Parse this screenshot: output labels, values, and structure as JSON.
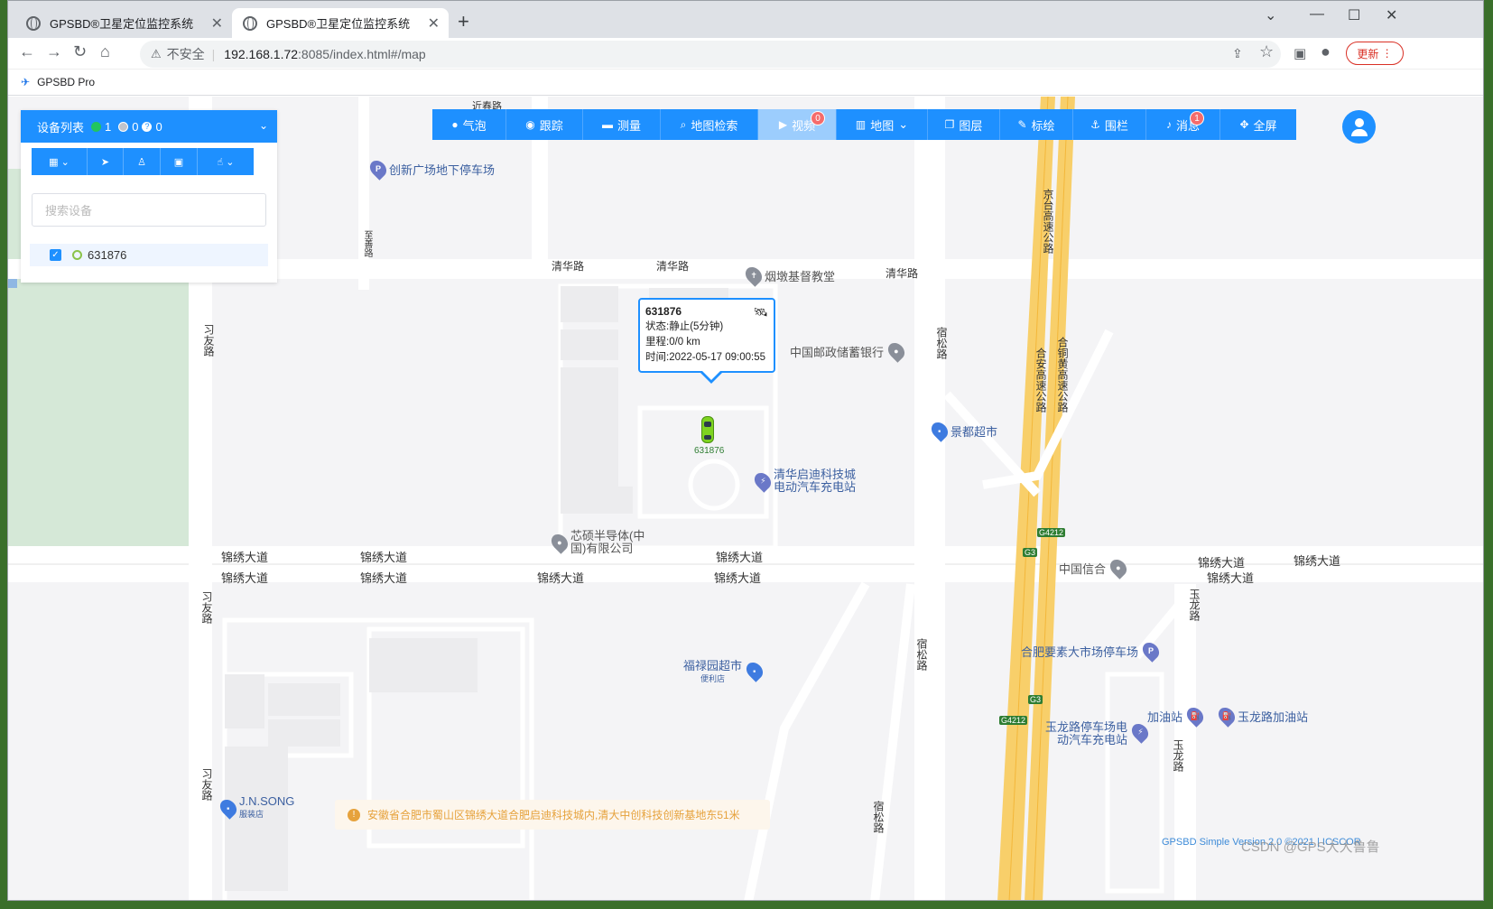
{
  "browser": {
    "tabs": [
      {
        "title": "GPSBD®卫星定位监控系统",
        "active": false
      },
      {
        "title": "GPSBD®卫星定位监控系统",
        "active": true
      }
    ],
    "security_label": "不安全",
    "url_host": "192.168.1.72",
    "url_rest": ":8085/index.html#/map",
    "update_label": "更新",
    "bookmark": "GPSBD Pro"
  },
  "panel": {
    "title": "设备列表",
    "online_count": "1",
    "offline_count": "0",
    "unknown_count": "0",
    "search_placeholder": "搜索设备",
    "devices": [
      {
        "name": "631876",
        "checked": true
      }
    ]
  },
  "toolbar": {
    "items": [
      {
        "label": "气泡",
        "icon": "chat-icon"
      },
      {
        "label": "跟踪",
        "icon": "eye-icon"
      },
      {
        "label": "测量",
        "icon": "ruler-icon"
      },
      {
        "label": "地图检索",
        "icon": "search-icon"
      },
      {
        "label": "视频",
        "icon": "video-icon",
        "badge": "0"
      },
      {
        "label": "地图",
        "icon": "map-icon"
      },
      {
        "label": "图层",
        "icon": "layers-icon"
      },
      {
        "label": "标绘",
        "icon": "pen-icon"
      },
      {
        "label": "围栏",
        "icon": "fence-icon"
      },
      {
        "label": "消息",
        "icon": "bell-icon",
        "badge": "1"
      },
      {
        "label": "全屏",
        "icon": "fullscreen-icon"
      }
    ]
  },
  "infowindow": {
    "device": "631876",
    "status": "状态:静止(5分钟)",
    "mileage": "里程:0/0 km",
    "time": "时间:2022-05-17 09:00:55"
  },
  "vehicle_label": "631876",
  "address": "安徽省合肥市蜀山区锦绣大道合肥启迪科技城内,清大中创科技创新基地东51米",
  "map": {
    "roads": [
      "清华路",
      "清华路",
      "清华路",
      "锦绣大道",
      "锦绣大道",
      "锦绣大道",
      "锦绣大道",
      "锦绣大道",
      "锦绣大道",
      "锦绣大道",
      "锦绣大道",
      "锦绣大道",
      "锦绣大道",
      "宿松路",
      "宿松路",
      "宿松路",
      "习友路",
      "习友路",
      "习友路",
      "京台高速公路",
      "合安高速公路",
      "合铜黄高速公路",
      "玉龙路",
      "玉龙路",
      "至善路",
      "近春路",
      "G4212",
      "G3"
    ],
    "pois": [
      "创新广场地下停车场",
      "烟墩基督教堂",
      "中国邮政储蓄银行",
      "景都超市",
      "清华启迪科技城电动汽车充电站",
      "芯硕半导体(中国)有限公司",
      "中国信合",
      "合肥要素大市场停车场",
      "福禄园超市",
      "便利店",
      "加油站",
      "玉龙路加油站",
      "玉龙路停车场电动汽车充电站",
      "J.N.SONG",
      "服装店"
    ]
  },
  "footer": "GPSBD Simple Version 2.0 ©2021 | ICSCOR",
  "watermark": "CSDN @GPS大大鲁鲁"
}
